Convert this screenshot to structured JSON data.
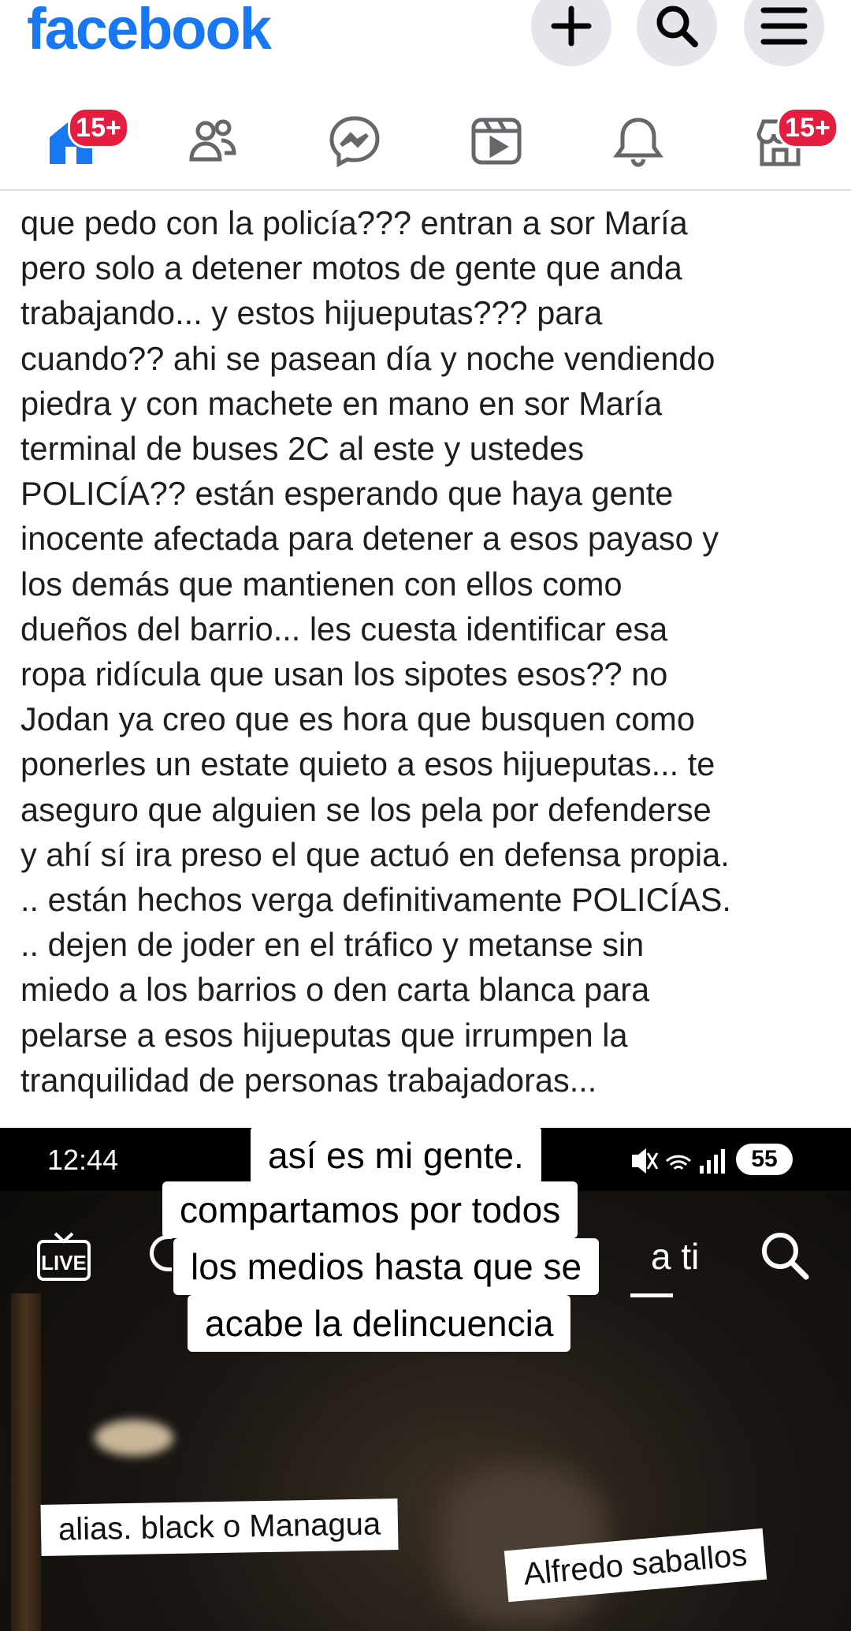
{
  "app": {
    "logo": "facebook",
    "nav_badges": {
      "home": "15+",
      "marketplace": "15+"
    }
  },
  "post": {
    "text_lines": [
      "que pedo con la policía??? entran a sor María",
      "pero solo a detener motos de gente que anda",
      "trabajando... y estos hijueputas??? para",
      "cuando?? ahi se pasean día y noche vendiendo",
      "piedra y con machete en mano en sor María",
      "terminal de buses 2C al este y ustedes",
      "POLICÍA?? están esperando que haya gente",
      "inocente afectada para detener a esos payaso y",
      "los demás que mantienen con ellos como",
      "dueños del barrio... les cuesta identificar esa",
      "ropa ridícula que usan los sipotes esos?? no",
      "Jodan ya creo que es hora que busquen como",
      "ponerles un estate quieto a esos hijueputas... te",
      "aseguro que alguien se los pela por defenderse",
      "y ahí sí ira preso el que actuó en defensa propia.",
      ".. están hechos verga definitivamente POLICÍAS.",
      ".. dejen de joder en el tráfico y metanse sin",
      "miedo a los barrios o den carta blanca para",
      "pelarse a esos hijueputas que irrumpen la",
      "tranquilidad de personas trabajadoras..."
    ]
  },
  "video": {
    "status_time": "12:44",
    "battery": "55",
    "live_label": "LIVE",
    "tab_partial": "a ti",
    "caption_lines": [
      "así es mi gente.",
      "compartamos por  todos",
      "los medios hasta que se",
      "acabe la delincuencia"
    ],
    "tag_1": "alias. black o Managua",
    "tag_2": "Alfredo saballos",
    "colors": {
      "video_bg": "#0b0a08",
      "brand": "#1877f2",
      "badge": "#e41e3f"
    }
  }
}
